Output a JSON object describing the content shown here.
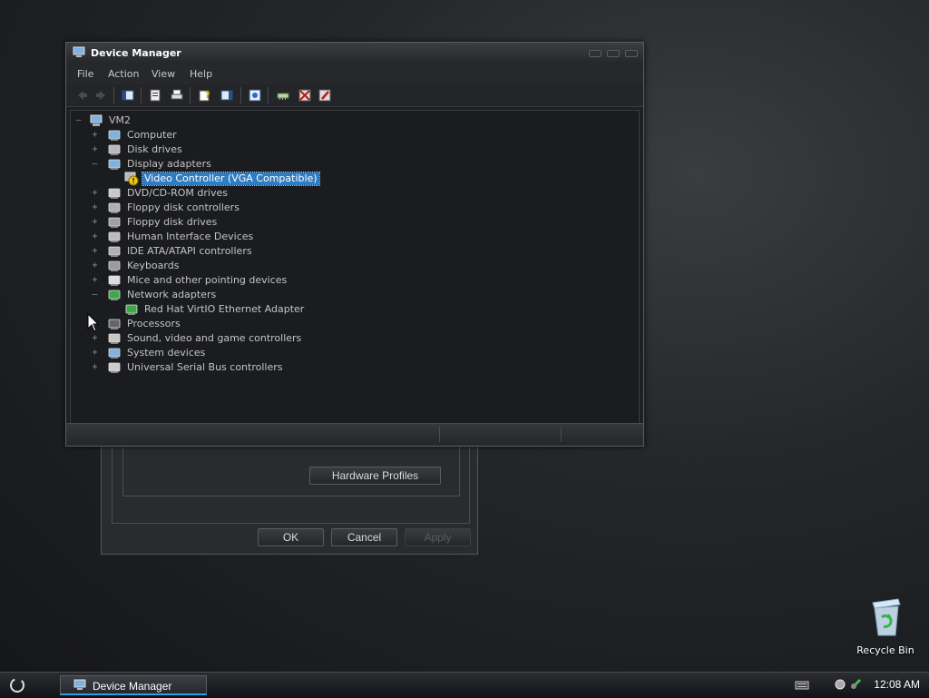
{
  "background_dialog": {
    "hardware_profiles_button": "Hardware Profiles",
    "ok_button": "OK",
    "cancel_button": "Cancel",
    "apply_button": "Apply"
  },
  "window": {
    "title": "Device Manager",
    "menu": [
      "File",
      "Action",
      "View",
      "Help"
    ],
    "toolbar_icons": [
      "back-icon",
      "forward-icon",
      "show-hide-icon",
      "properties-icon",
      "print-icon",
      "help-icon",
      "console-tree-icon",
      "scan-hardware-icon",
      "update-driver-icon",
      "uninstall-icon",
      "disable-icon"
    ]
  },
  "tree": {
    "root": "VM2",
    "items": [
      {
        "label": "Computer",
        "expander": "+",
        "icon": "computer-icon"
      },
      {
        "label": "Disk drives",
        "expander": "+",
        "icon": "disk-drive-icon"
      },
      {
        "label": "Display adapters",
        "expander": "–",
        "icon": "display-adapter-icon"
      },
      {
        "label": "Video Controller (VGA Compatible)",
        "child": true,
        "selected": true,
        "icon": "warning-icon"
      },
      {
        "label": "DVD/CD-ROM drives",
        "expander": "+",
        "icon": "dvd-icon"
      },
      {
        "label": "Floppy disk controllers",
        "expander": "+",
        "icon": "controller-icon"
      },
      {
        "label": "Floppy disk drives",
        "expander": "+",
        "icon": "floppy-icon"
      },
      {
        "label": "Human Interface Devices",
        "expander": "+",
        "icon": "hid-icon"
      },
      {
        "label": "IDE ATA/ATAPI controllers",
        "expander": "+",
        "icon": "ide-icon"
      },
      {
        "label": "Keyboards",
        "expander": "+",
        "icon": "keyboard-icon"
      },
      {
        "label": "Mice and other pointing devices",
        "expander": "+",
        "icon": "mouse-icon"
      },
      {
        "label": "Network adapters",
        "expander": "–",
        "icon": "network-adapter-icon"
      },
      {
        "label": "Red Hat VirtIO Ethernet Adapter",
        "child": true,
        "icon": "network-card-icon"
      },
      {
        "label": "Processors",
        "expander": "+",
        "icon": "processor-icon"
      },
      {
        "label": "Sound, video and game controllers",
        "expander": "+",
        "icon": "sound-icon"
      },
      {
        "label": "System devices",
        "expander": "+",
        "icon": "system-devices-icon"
      },
      {
        "label": "Universal Serial Bus controllers",
        "expander": "+",
        "icon": "usb-icon"
      }
    ]
  },
  "desktop": {
    "recycle_bin_label": "Recycle Bin"
  },
  "taskbar": {
    "task_label": "Device Manager",
    "clock": "12:08 AM"
  },
  "colors": {
    "selection": "#2f7cc0",
    "taskbar_accent": "#2aa0e6",
    "background": "#1a1b1d"
  }
}
